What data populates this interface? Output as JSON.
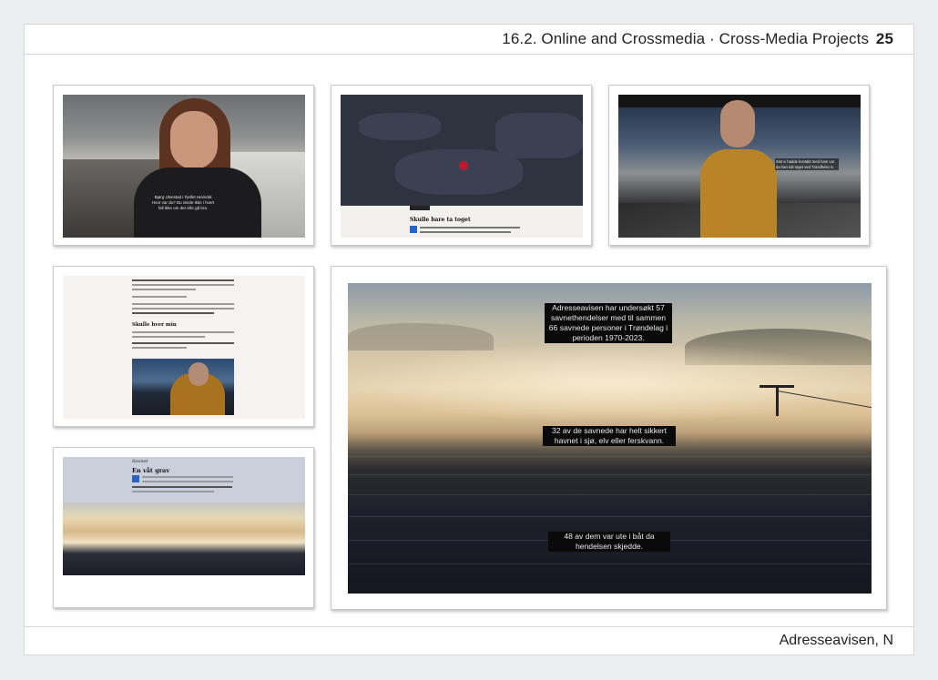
{
  "header": {
    "section": "16.2. Online and Crossmedia · Cross-Media Projects",
    "page_number": "25"
  },
  "footer": {
    "source": "Adresseavisen, N"
  },
  "screens": {
    "portrait": {
      "caption": "Bjørg Ulvestad i Fjellet Heimdal Hvor var du? Du visste ikke i hvert fall ikke om det ville gå bra."
    },
    "map": {
      "headline": "Skulle bare ta toget"
    },
    "station": {
      "caption": "Sist vi hadde kontakt med ham var da han tok toget ved Trondheim S."
    },
    "article": {
      "subheading": "Skulle hver min"
    },
    "fog_article": {
      "kicker": "Savnet",
      "headline": "En våt grav"
    },
    "feature": {
      "caption_1": "Adresseavisen har undersøkt 57 savnethendelser med til sammen 66 savnede personer i Trøndelag i perioden 1970-2023.",
      "caption_2": "32 av de savnede har helt sikkert havnet i sjø, elv eller ferskvann.",
      "caption_3": "48 av dem var ute i båt da hendelsen skjedde."
    }
  },
  "colors": {
    "accent_dot": "#c2182c",
    "drop_cap": "#2a63c4",
    "page_bg": "#ecedef"
  }
}
